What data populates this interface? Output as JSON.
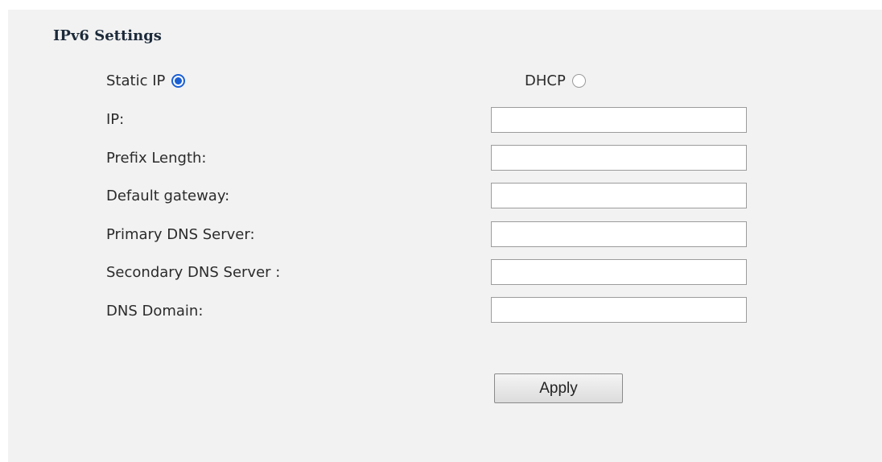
{
  "section": {
    "title": "IPv6 Settings"
  },
  "mode": {
    "static_label": "Static IP",
    "static_selected": true,
    "dhcp_label": "DHCP",
    "dhcp_selected": false
  },
  "fields": [
    {
      "label": "IP:",
      "value": ""
    },
    {
      "label": "Prefix Length:",
      "value": ""
    },
    {
      "label": "Default gateway:",
      "value": ""
    },
    {
      "label": "Primary DNS Server:",
      "value": ""
    },
    {
      "label": "Secondary DNS Server :",
      "value": ""
    },
    {
      "label": "DNS Domain:",
      "value": ""
    }
  ],
  "actions": {
    "apply_label": "Apply"
  },
  "colors": {
    "panel_background": "#f2f2f2",
    "radio_accent": "#1a5fd4"
  }
}
